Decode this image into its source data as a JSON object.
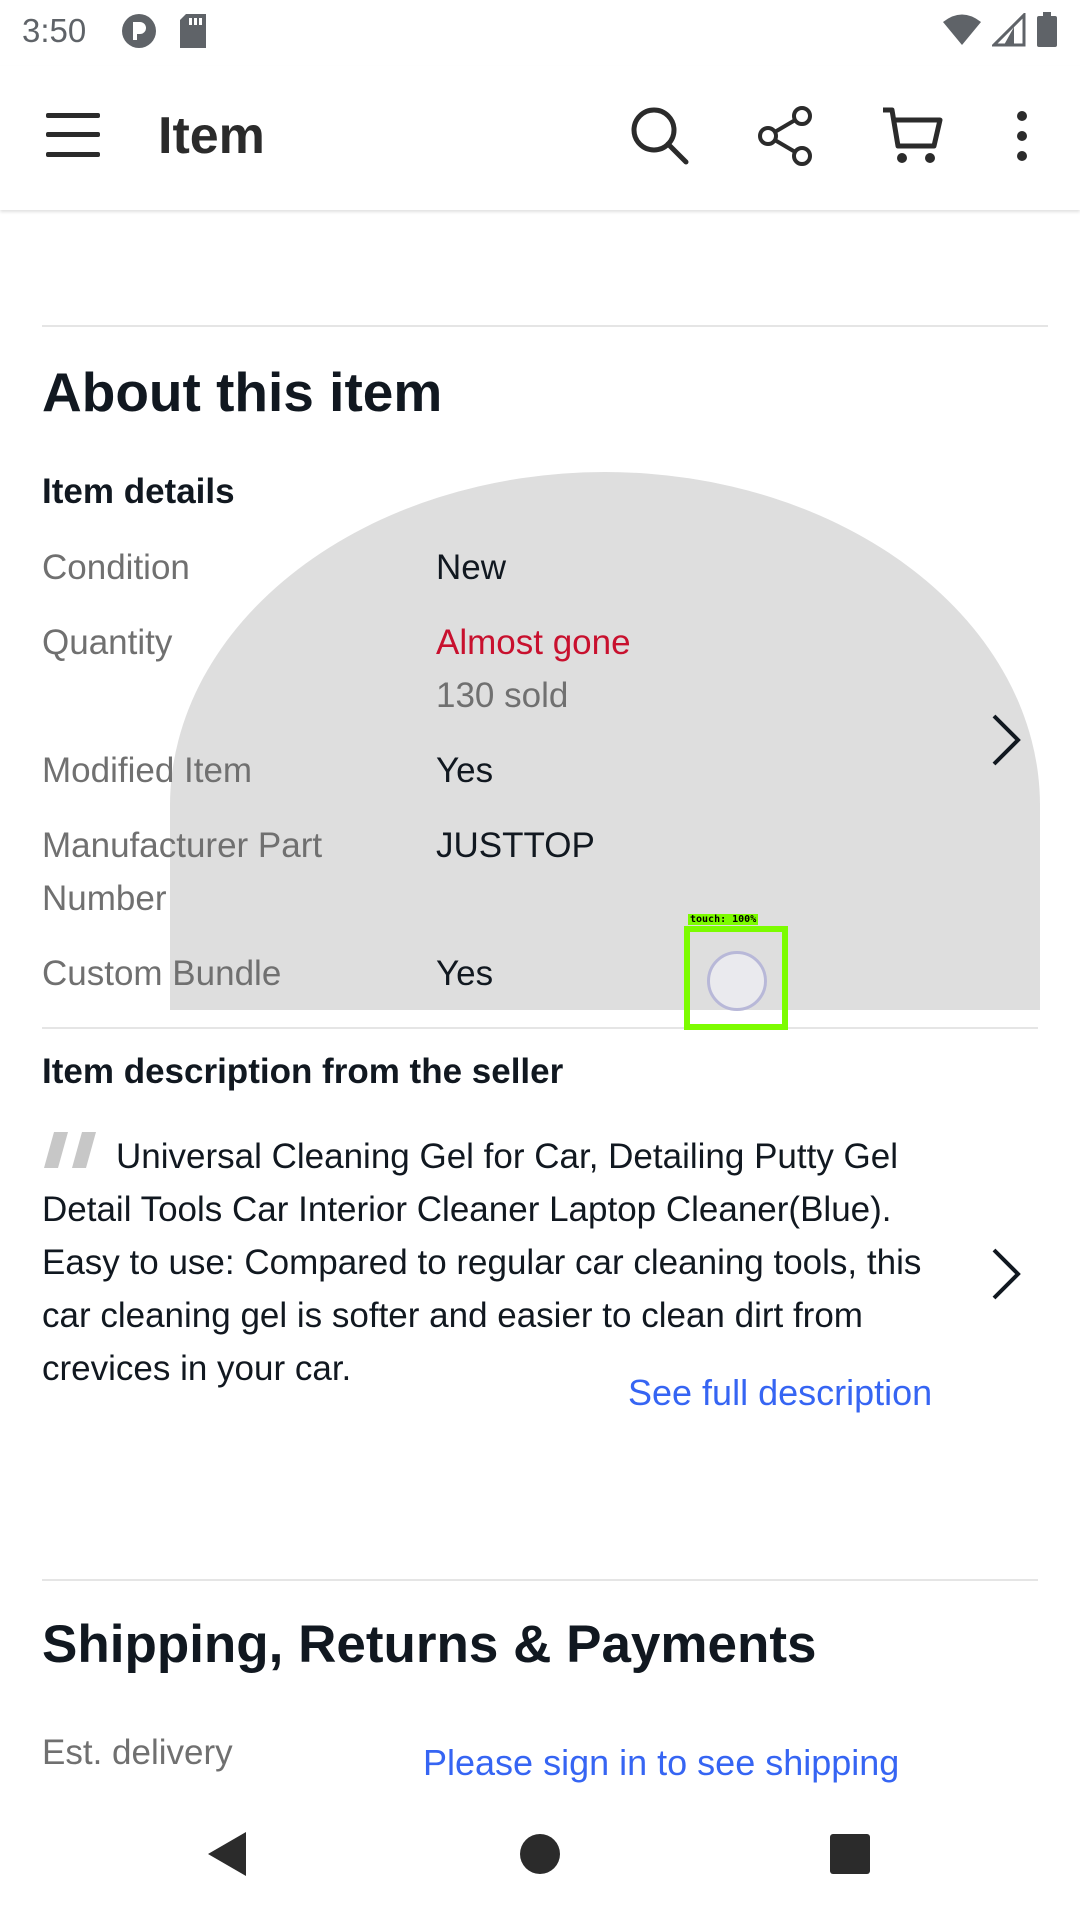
{
  "status_bar": {
    "time": "3:50",
    "icons_left": [
      "data-saver-icon",
      "sd-card-icon"
    ],
    "icons_right": [
      "wifi-icon",
      "signal-icon",
      "battery-icon"
    ]
  },
  "app_bar": {
    "title": "Item",
    "actions": [
      "search-icon",
      "share-icon",
      "cart-icon",
      "more-vert-icon"
    ]
  },
  "about": {
    "heading": "About this item",
    "details_heading": "Item details",
    "rows": [
      {
        "label": "Condition",
        "value": "New"
      },
      {
        "label": "Quantity",
        "value": "Almost gone",
        "sub_value": "130 sold"
      },
      {
        "label": "Modified Item",
        "value": "Yes"
      },
      {
        "label": "Manufacturer Part Number",
        "value": "JUSTTOP"
      },
      {
        "label": "Custom Bundle",
        "value": "Yes"
      }
    ]
  },
  "description": {
    "heading": "Item description from the seller",
    "text": "Universal Cleaning Gel for Car, Detailing Putty Gel Detail Tools Car Interior Cleaner Laptop Cleaner(Blue). Easy to use: Compared to regular car cleaning tools, this car cleaning gel is softer and easier to clean dirt from crevices in your car.",
    "link": "See full description"
  },
  "shipping": {
    "heading": "Shipping, Returns & Payments",
    "est_label": "Est. delivery",
    "est_link": "Please sign in to see shipping details to your location"
  },
  "touch_overlay": {
    "label": "touch: 100%"
  },
  "colors": {
    "alert": "#c8102e",
    "link": "#3665f3",
    "touch_box": "#7cfc00",
    "ripple": "#dedede"
  },
  "nav_bar": {
    "buttons": [
      "back-icon",
      "home-icon",
      "recents-icon"
    ]
  }
}
